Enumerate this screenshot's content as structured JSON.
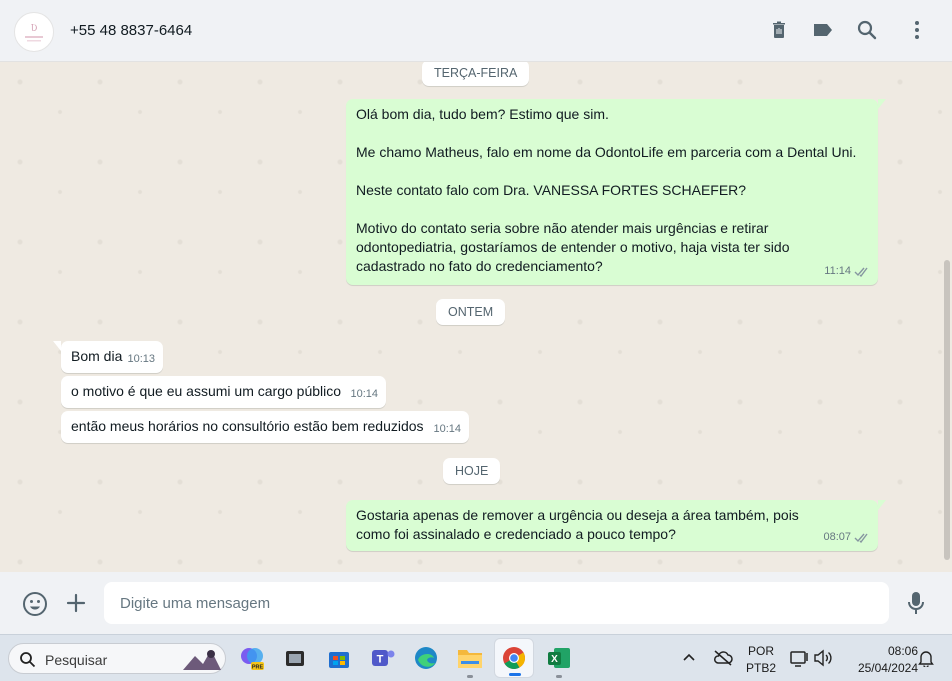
{
  "header": {
    "contact": "+55 48 8837-6464",
    "avatar_icon": "clinic-logo-icon",
    "icons": [
      "delete-icon",
      "label-icon",
      "search-icon",
      "menu-icon"
    ]
  },
  "chat": {
    "date_1": "TERÇA-FEIRA",
    "msg_out_1": {
      "lines": [
        "Olá bom dia, tudo bem? Estimo que sim.",
        "Me chamo Matheus, falo em nome da OdontoLife em parceria com a Dental Uni.",
        "Neste contato falo com Dra. VANESSA FORTES SCHAEFER?",
        "Motivo do contato seria sobre não atender mais urgências e retirar odontopediatria, gostaríamos de entender o motivo, haja vista ter sido cadastrado no fato do credenciamento?"
      ],
      "time": "11:14"
    },
    "date_2": "ONTEM",
    "msg_in_1": {
      "text": "Bom dia",
      "time": "10:13"
    },
    "msg_in_2": {
      "text": "o motivo é que eu assumi um cargo público",
      "time": "10:14"
    },
    "msg_in_3": {
      "text": "então meus horários no consultório estão bem reduzidos",
      "time": "10:14"
    },
    "date_3": "HOJE",
    "msg_out_2": {
      "text": "Gostaria apenas de remover a urgência ou deseja a área também, pois como foi assinalado e credenciado a pouco tempo?",
      "time": "08:07"
    }
  },
  "composer": {
    "placeholder": "Digite uma mensagem",
    "icons": [
      "emoji-icon",
      "plus-icon",
      "microphone-icon"
    ]
  },
  "taskbar": {
    "search_label": "Pesquisar",
    "lang_line1": "POR",
    "lang_line2": "PTB2",
    "time": "08:06",
    "date": "25/04/2024"
  },
  "colors": {
    "outgoing_bubble": "#d9fdd3",
    "incoming_bubble": "#ffffff",
    "chat_bg": "#efeae2",
    "read_tick": "#8696a0"
  }
}
